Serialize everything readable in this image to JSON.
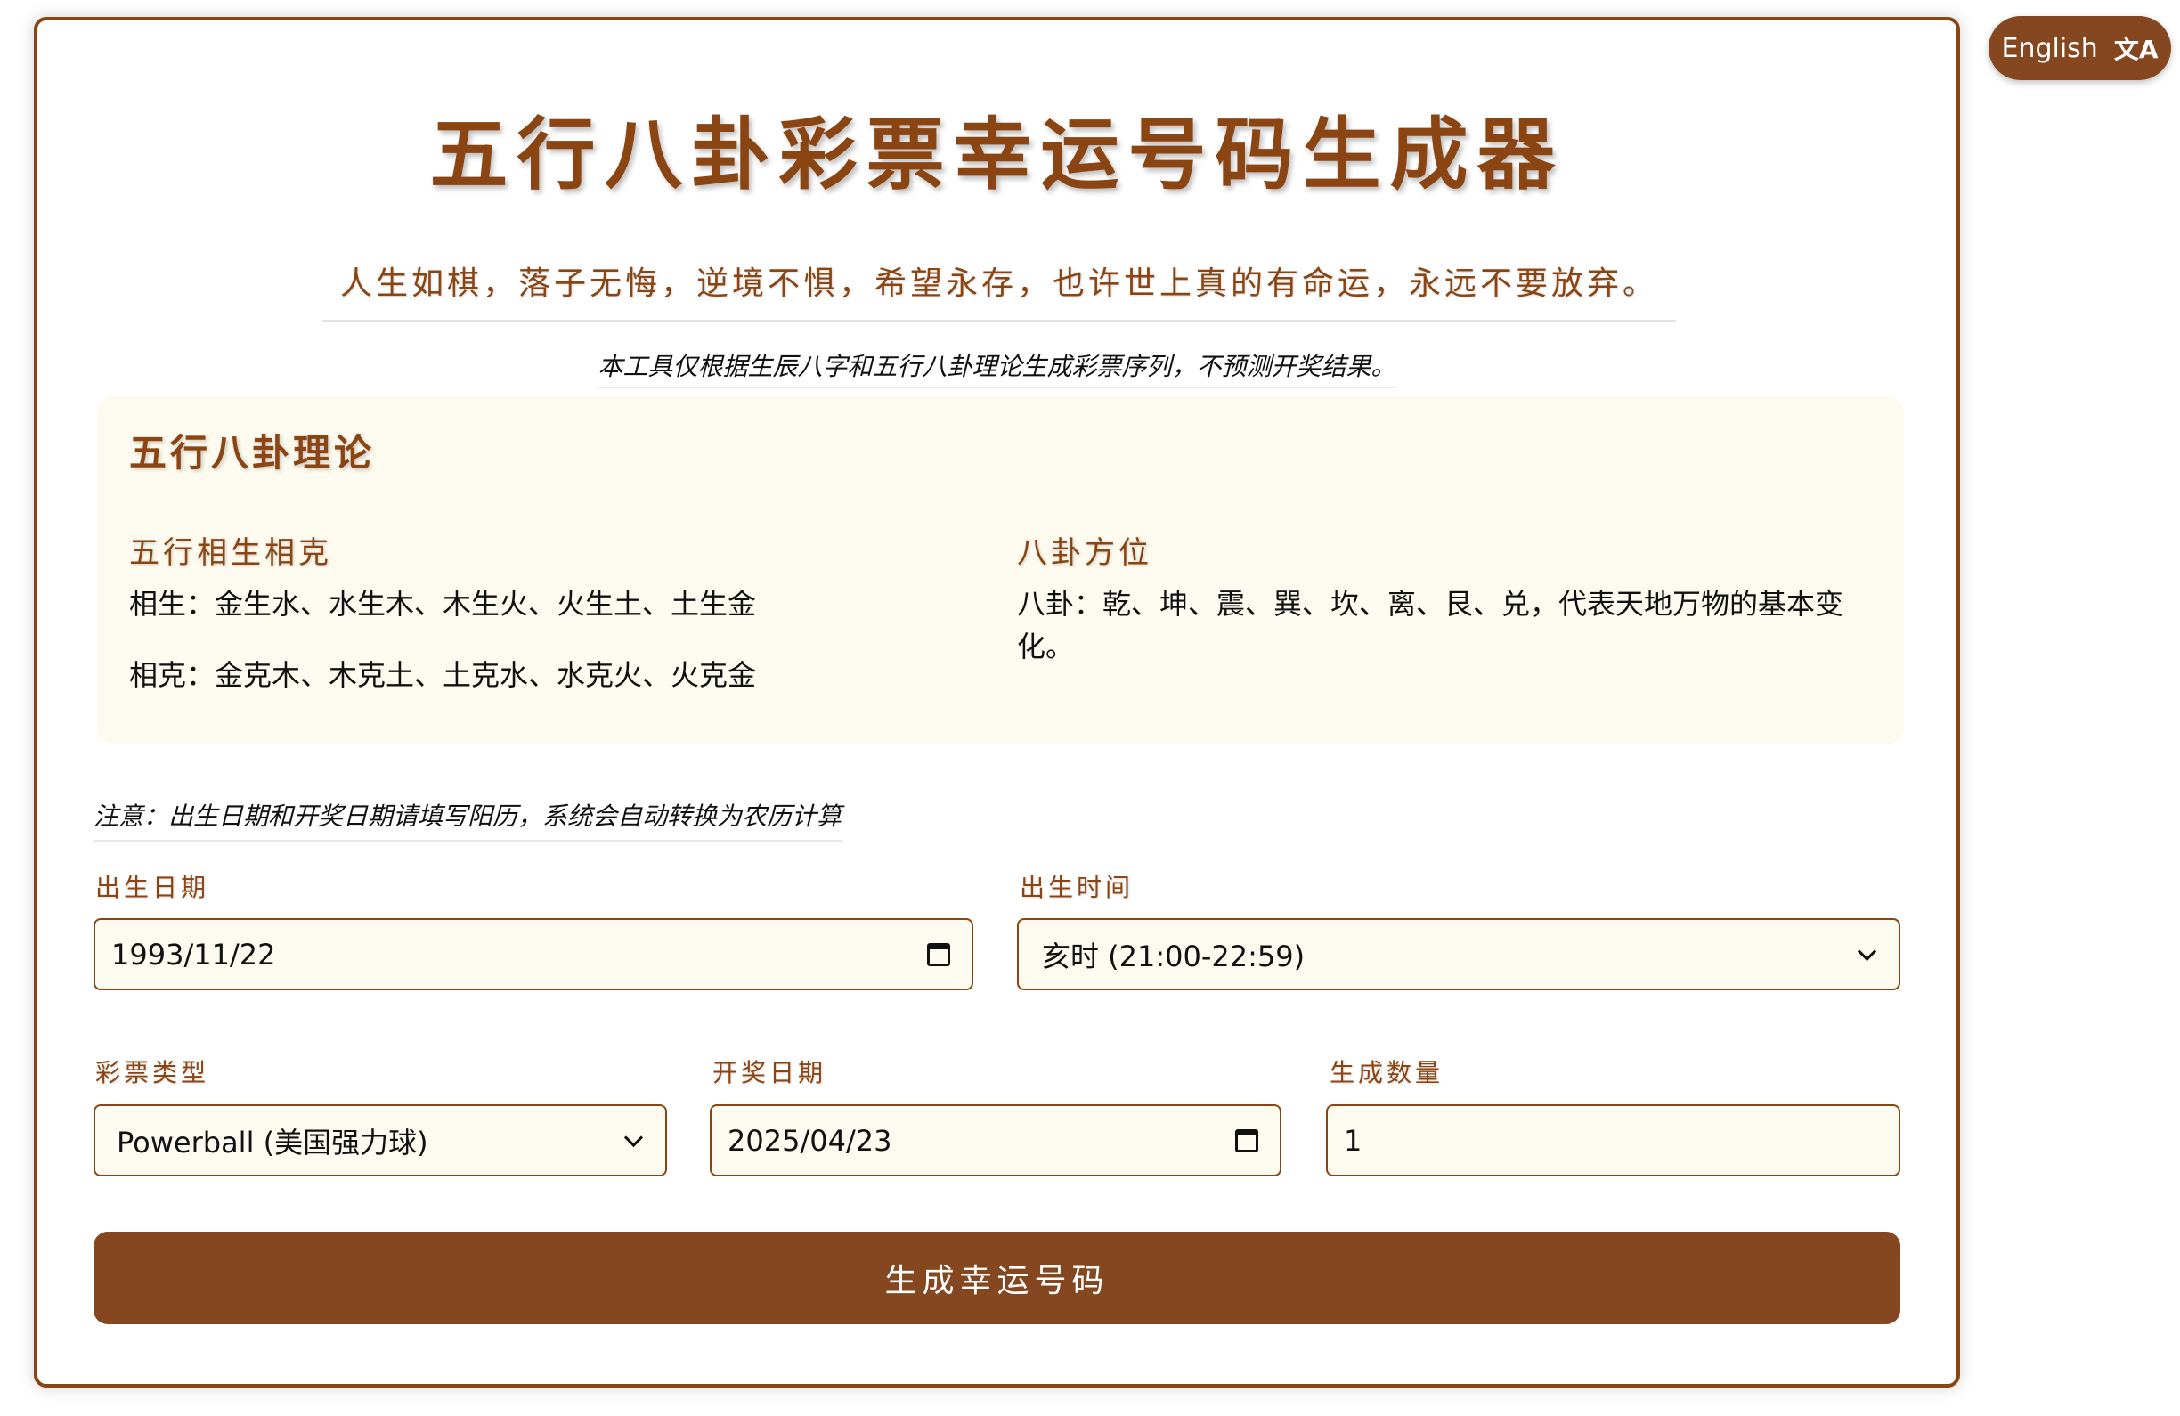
{
  "language_button": {
    "label": "English",
    "icon": "translate-icon"
  },
  "header": {
    "title": "五行八卦彩票幸运号码生成器",
    "motto": "人生如棋，落子无悔，逆境不惧，希望永存，也许世上真的有命运，永远不要放弃。",
    "disclaimer": "本工具仅根据生辰八字和五行八卦理论生成彩票序列，不预测开奖结果。"
  },
  "theory": {
    "title": "五行八卦理论",
    "wuxing": {
      "heading": "五行相生相克",
      "sheng": "相生：金生水、水生木、木生火、火生土、土生金",
      "ke": "相克：金克木、木克土、土克水、水克火、火克金"
    },
    "bagua": {
      "heading": "八卦方位",
      "text": "八卦：乾、坤、震、巽、坎、离、艮、兑，代表天地万物的基本变化。"
    }
  },
  "form": {
    "note": "注意：出生日期和开奖日期请填写阳历，系统会自动转换为农历计算",
    "birth_date": {
      "label": "出生日期",
      "value": "1993/11/22"
    },
    "birth_time": {
      "label": "出生时间",
      "value": "亥时 (21:00-22:59)"
    },
    "lottery_type": {
      "label": "彩票类型",
      "value": "Powerball (美国强力球)"
    },
    "draw_date": {
      "label": "开奖日期",
      "value": "2025/04/23"
    },
    "count": {
      "label": "生成数量",
      "value": "1"
    },
    "submit_label": "生成幸运号码"
  },
  "colors": {
    "accent": "#8b4513",
    "button": "#84471f",
    "panel_bg": "#fdfbef"
  }
}
